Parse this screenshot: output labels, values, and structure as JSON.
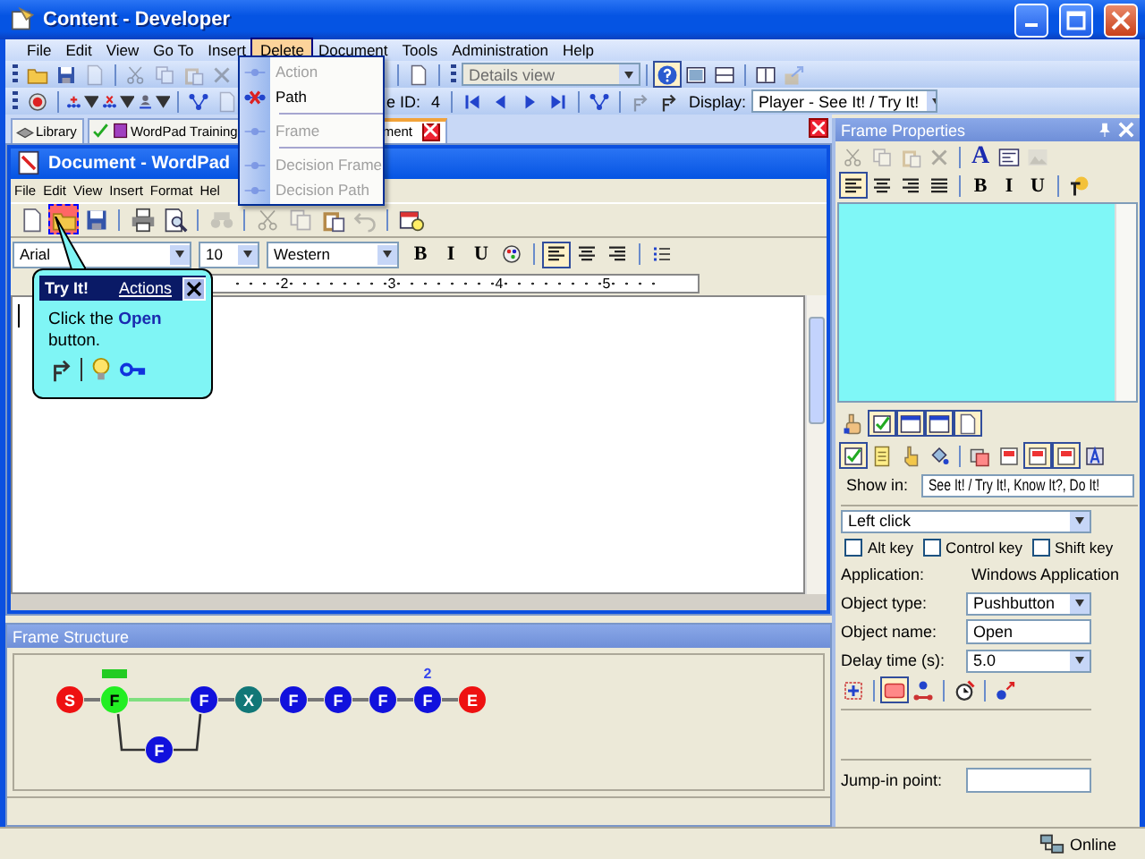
{
  "window": {
    "title": "Content - Developer"
  },
  "menu": [
    {
      "label": "File",
      "selected": false
    },
    {
      "label": "Edit",
      "selected": false
    },
    {
      "label": "View",
      "selected": false
    },
    {
      "label": "Go To",
      "selected": false
    },
    {
      "label": "Insert",
      "selected": false
    },
    {
      "label": "Delete",
      "selected": true
    },
    {
      "label": "Document",
      "selected": false
    },
    {
      "label": "Tools",
      "selected": false
    },
    {
      "label": "Administration",
      "selected": false
    },
    {
      "label": "Help",
      "selected": false
    }
  ],
  "delete_menu": [
    {
      "kind": "item",
      "label": "Action",
      "disabled": true
    },
    {
      "kind": "item",
      "label": "Path",
      "disabled": false
    },
    {
      "kind": "separator"
    },
    {
      "kind": "item",
      "label": "Frame",
      "disabled": true
    },
    {
      "kind": "separator"
    },
    {
      "kind": "item",
      "label": "Decision Frame",
      "disabled": true
    },
    {
      "kind": "item",
      "label": "Decision Path",
      "disabled": true
    }
  ],
  "toolbar_1": [
    {
      "kind": "grip"
    },
    {
      "kind": "button",
      "disabled": false,
      "pressed": false
    },
    {
      "kind": "button",
      "disabled": false,
      "pressed": false
    },
    {
      "kind": "button",
      "disabled": true,
      "pressed": false
    },
    {
      "kind": "separator"
    },
    {
      "kind": "button",
      "disabled": true,
      "pressed": false
    },
    {
      "kind": "button",
      "disabled": true,
      "pressed": false
    },
    {
      "kind": "button",
      "disabled": true,
      "pressed": false
    },
    {
      "kind": "button",
      "disabled": true,
      "pressed": false
    },
    {
      "kind": "separator"
    },
    {
      "kind": "button",
      "disabled": false,
      "pressed": false
    },
    {
      "kind": "separator"
    },
    {
      "kind": "grip"
    },
    {
      "kind": "combo",
      "value": "Details view",
      "disabled": true
    },
    {
      "kind": "separator"
    },
    {
      "kind": "button",
      "disabled": false,
      "pressed": true
    },
    {
      "kind": "button",
      "disabled": false,
      "pressed": false
    },
    {
      "kind": "button",
      "disabled": false,
      "pressed": false
    },
    {
      "kind": "separator"
    },
    {
      "kind": "button",
      "disabled": false,
      "pressed": false
    },
    {
      "kind": "button",
      "disabled": true,
      "pressed": false
    }
  ],
  "toolbar_2": [
    {
      "kind": "grip"
    },
    {
      "kind": "button",
      "disabled": false
    },
    {
      "kind": "separator"
    },
    {
      "kind": "dropdown",
      "disabled": false
    },
    {
      "kind": "dropdown",
      "disabled": false
    },
    {
      "kind": "dropdown",
      "disabled": false
    },
    {
      "kind": "separator"
    },
    {
      "kind": "button",
      "disabled": false
    },
    {
      "kind": "button",
      "disabled": true
    },
    {
      "kind": "label",
      "text": "e ID:"
    },
    {
      "kind": "label",
      "text": "4"
    },
    {
      "kind": "separator"
    },
    {
      "kind": "button",
      "disabled": false
    },
    {
      "kind": "button",
      "disabled": false
    },
    {
      "kind": "button",
      "disabled": false
    },
    {
      "kind": "button",
      "disabled": false
    },
    {
      "kind": "separator"
    },
    {
      "kind": "button",
      "disabled": false
    },
    {
      "kind": "separator"
    },
    {
      "kind": "button",
      "disabled": true
    },
    {
      "kind": "button",
      "disabled": false
    },
    {
      "kind": "label",
      "text": "Display:"
    },
    {
      "kind": "combo",
      "value": "Player - See It! / Try It!",
      "disabled": false
    }
  ],
  "tabs": [
    {
      "label": "Library",
      "selected": false,
      "checked": false
    },
    {
      "label": "WordPad Training",
      "selected": false,
      "checked": true
    },
    {
      "label": "ment",
      "selected": true,
      "checked": false
    }
  ],
  "wordpad": {
    "title": "Document - WordPad",
    "menu": [
      "File",
      "Edit",
      "View",
      "Insert",
      "Format",
      "Hel"
    ],
    "toolbar": [
      {
        "kind": "button",
        "disabled": false,
        "pressed": false
      },
      {
        "kind": "button",
        "disabled": false,
        "pressed": true
      },
      {
        "kind": "button",
        "disabled": false,
        "pressed": false
      },
      {
        "kind": "separator"
      },
      {
        "kind": "button",
        "disabled": false,
        "pressed": false
      },
      {
        "kind": "button",
        "disabled": false,
        "pressed": false
      },
      {
        "kind": "separator"
      },
      {
        "kind": "button",
        "disabled": true,
        "pressed": false
      },
      {
        "kind": "separator"
      },
      {
        "kind": "button",
        "disabled": true,
        "pressed": false
      },
      {
        "kind": "button",
        "disabled": true,
        "pressed": false
      },
      {
        "kind": "button",
        "disabled": false,
        "pressed": false
      },
      {
        "kind": "button",
        "disabled": true,
        "pressed": false
      },
      {
        "kind": "separator"
      },
      {
        "kind": "button",
        "disabled": false,
        "pressed": false
      }
    ],
    "format_bar": [
      {
        "kind": "combo",
        "value": "Arial"
      },
      {
        "kind": "combo",
        "value": "10"
      },
      {
        "kind": "combo",
        "value": "Western"
      },
      {
        "kind": "button",
        "text": "B",
        "pressed": false
      },
      {
        "kind": "button",
        "text": "I",
        "pressed": false
      },
      {
        "kind": "button",
        "text": "U",
        "pressed": false
      },
      {
        "kind": "button",
        "pressed": false
      },
      {
        "kind": "separator"
      },
      {
        "kind": "button",
        "pressed": true
      },
      {
        "kind": "button",
        "pressed": false
      },
      {
        "kind": "button",
        "pressed": false
      },
      {
        "kind": "separator"
      },
      {
        "kind": "button",
        "pressed": false
      }
    ],
    "ruler": [
      "2",
      "3",
      "4",
      "5"
    ]
  },
  "bubble": {
    "title": "Try It!",
    "link": "Actions",
    "text": "Click the **Open** button."
  },
  "frame_structure": {
    "title": "Frame Structure",
    "nodes": [
      {
        "letter": "S",
        "color": "#ee1111",
        "selected": false
      },
      {
        "letter": "F",
        "color": "#22ee22",
        "selected": true,
        "branch_nodes": [
          {
            "letter": "F",
            "color": "#1111dd",
            "selected": false
          }
        ]
      },
      {
        "letter": "F",
        "color": "#1111dd",
        "selected": false
      },
      {
        "letter": "X",
        "color": "#117777",
        "selected": false
      },
      {
        "letter": "F",
        "color": "#1111dd",
        "selected": false
      },
      {
        "letter": "F",
        "color": "#1111dd",
        "selected": false
      },
      {
        "letter": "F",
        "color": "#1111dd",
        "selected": false
      },
      {
        "letter": "F",
        "color": "#1111dd",
        "selected": false,
        "note": "2"
      },
      {
        "letter": "E",
        "color": "#ee1111",
        "selected": false
      }
    ]
  },
  "frame_properties": {
    "title": "Frame Properties",
    "toolbar_1": [
      {
        "kind": "button",
        "disabled": true
      },
      {
        "kind": "button",
        "disabled": true
      },
      {
        "kind": "button",
        "disabled": true
      },
      {
        "kind": "button",
        "disabled": true
      },
      {
        "kind": "separator"
      },
      {
        "kind": "button",
        "text": "A",
        "disabled": false
      },
      {
        "kind": "button",
        "disabled": false
      },
      {
        "kind": "button",
        "disabled": true
      }
    ],
    "toolbar_2": [
      {
        "kind": "button",
        "pressed": true
      },
      {
        "kind": "button",
        "pressed": false
      },
      {
        "kind": "button",
        "pressed": false
      },
      {
        "kind": "button",
        "pressed": false
      },
      {
        "kind": "separator"
      },
      {
        "kind": "button",
        "text": "B",
        "pressed": false
      },
      {
        "kind": "button",
        "text": "I",
        "pressed": false
      },
      {
        "kind": "button",
        "text": "U",
        "pressed": false
      },
      {
        "kind": "separator"
      },
      {
        "kind": "button",
        "pressed": false
      }
    ],
    "icons_1": [
      {
        "kind": "button",
        "pressed": false
      },
      {
        "kind": "button",
        "pressed": true
      },
      {
        "kind": "button",
        "pressed": true
      },
      {
        "kind": "button",
        "pressed": true
      },
      {
        "kind": "button",
        "pressed": true
      }
    ],
    "icons_2": [
      {
        "kind": "button",
        "pressed": true
      },
      {
        "kind": "button",
        "pressed": false
      },
      {
        "kind": "button",
        "pressed": false
      },
      {
        "kind": "button",
        "pressed": false
      },
      {
        "kind": "separator"
      },
      {
        "kind": "button",
        "pressed": false
      },
      {
        "kind": "button",
        "pressed": false
      },
      {
        "kind": "button",
        "pressed": true
      },
      {
        "kind": "button",
        "pressed": true
      },
      {
        "kind": "button",
        "pressed": false
      }
    ],
    "show_in": {
      "label": "Show in:",
      "value": "See It! / Try It!, Know It?, Do It!"
    },
    "action": "Left click",
    "keys": [
      {
        "label": "Alt key",
        "checked": false
      },
      {
        "label": "Control key",
        "checked": false
      },
      {
        "label": "Shift key",
        "checked": false
      }
    ],
    "application": {
      "label": "Application:",
      "value": "Windows Application"
    },
    "object_type": {
      "label": "Object type:",
      "value": "Pushbutton"
    },
    "object_name": {
      "label": "Object name:",
      "value": "Open"
    },
    "delay": {
      "label": "Delay time (s):",
      "value": "5.0"
    },
    "icons_3": [
      {
        "kind": "button",
        "pressed": false
      },
      {
        "kind": "separator"
      },
      {
        "kind": "button",
        "pressed": true
      },
      {
        "kind": "button",
        "pressed": false
      },
      {
        "kind": "separator"
      },
      {
        "kind": "button",
        "pressed": false
      },
      {
        "kind": "separator"
      },
      {
        "kind": "button",
        "pressed": false
      }
    ],
    "jump_in": {
      "label": "Jump-in point:"
    }
  },
  "status_bar": {
    "status": "Online"
  }
}
